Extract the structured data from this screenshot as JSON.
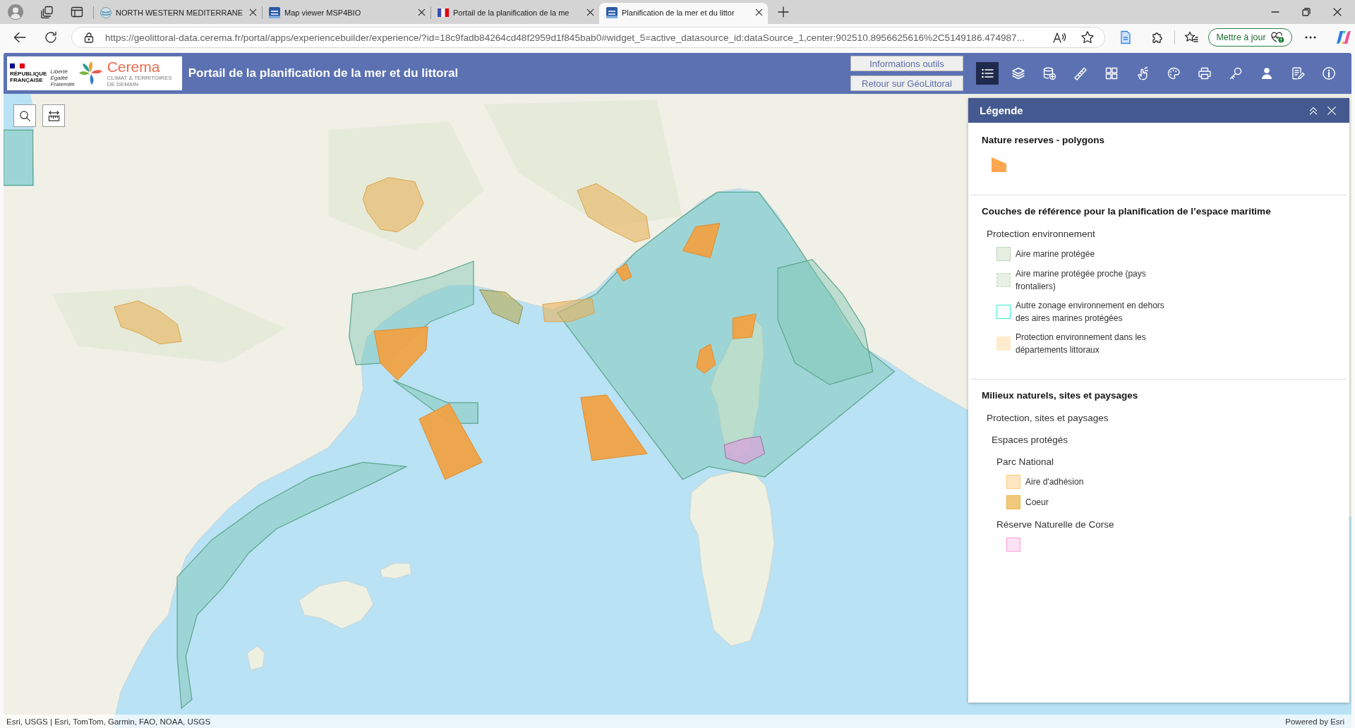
{
  "browser": {
    "tabs": [
      {
        "kind": "globe",
        "title": "NORTH WESTERN MEDITERRANE",
        "selected": false
      },
      {
        "kind": "logo",
        "title": "Map viewer MSP4BIO",
        "selected": false
      },
      {
        "kind": "flag",
        "title": "Portail de la planification de la me",
        "selected": false
      },
      {
        "kind": "logo",
        "title": "Planification de la mer et du littor",
        "selected": true
      }
    ],
    "address_bar": {
      "url": "https://geolittoral-data.cerema.fr/portal/apps/experiencebuilder/experience/?id=18c9fadb84264cd48f2959d1f845bab0#widget_5=active_datasource_id:dataSource_1,center:902510.8956625616%2C5149186.474987..."
    },
    "update_button": "Mettre à jour"
  },
  "header": {
    "logo": {
      "republic": "RÉPUBLIQUE FRANÇAISE",
      "motto": "Liberté Égalité Fraternité",
      "brand": "Cerema",
      "tagline": "CLIMAT & TERRITOIRES DE DEMAIN"
    },
    "title": "Portail de la planification de la mer et du littoral",
    "buttons": [
      "Informations outils",
      "Retour sur GéoLittoral"
    ],
    "tools": [
      {
        "kind": "legend",
        "selected": true
      },
      {
        "kind": "layers",
        "selected": false
      },
      {
        "kind": "add-data",
        "selected": false
      },
      {
        "kind": "measure",
        "selected": false
      },
      {
        "kind": "basemap",
        "selected": false
      },
      {
        "kind": "select",
        "selected": false
      },
      {
        "kind": "sketch",
        "selected": false
      },
      {
        "kind": "print",
        "selected": false
      },
      {
        "kind": "key",
        "selected": false
      },
      {
        "kind": "user",
        "selected": false
      },
      {
        "kind": "notes",
        "selected": false
      },
      {
        "kind": "info",
        "selected": false
      }
    ]
  },
  "legend": {
    "title": "Légende",
    "sections": [
      {
        "title": "Nature reserves - polygons",
        "children": [
          {
            "kind": "polygon",
            "color": "#fca64f"
          }
        ]
      },
      {
        "title": "Couches de référence pour la planification de l’espace maritime",
        "children": [
          {
            "kind": "group",
            "label": "Protection environnement",
            "children": [
              {
                "kind": "fill",
                "label": "Aire marine protégée",
                "color": "#e6efe2",
                "dashed": false
              },
              {
                "kind": "fill",
                "label": "Aire marine protégée proche (pays frontaliers)",
                "color": "#e8f0e4",
                "dashed": true
              },
              {
                "kind": "outline",
                "label": "Autre zonage environnement en dehors des aires marines protégées",
                "color": "#2ef0cc",
                "dashed": false
              },
              {
                "kind": "flat",
                "label": "Protection environnement dans les départements littoraux",
                "color": "#ffebcd"
              }
            ]
          }
        ]
      },
      {
        "title": "Milieux naturels, sites et paysages",
        "children": [
          {
            "kind": "group",
            "label": "Protection, sites et paysages",
            "children": [
              {
                "kind": "group",
                "label": "Espaces protégés",
                "children": [
                  {
                    "kind": "group",
                    "label": "Parc National",
                    "children": [
                      {
                        "kind": "fill",
                        "label": "Aire d'adhésion",
                        "color": "#fde6c0",
                        "dashed": false
                      },
                      {
                        "kind": "fill",
                        "label": "Coeur",
                        "color": "#f0c97b",
                        "dashed": false
                      }
                    ]
                  },
                  {
                    "kind": "group",
                    "label": "Réserve Naturelle de Corse",
                    "children": [
                      {
                        "kind": "fill",
                        "color": "#fde1f4",
                        "dashed": false
                      }
                    ]
                  }
                ]
              }
            ]
          }
        ]
      }
    ]
  },
  "attribution": {
    "sources": "Esri, USGS | Esri, TomTom, Garmin, FAO, NOAA, USGS",
    "powered_by": "Powered by Esri"
  }
}
